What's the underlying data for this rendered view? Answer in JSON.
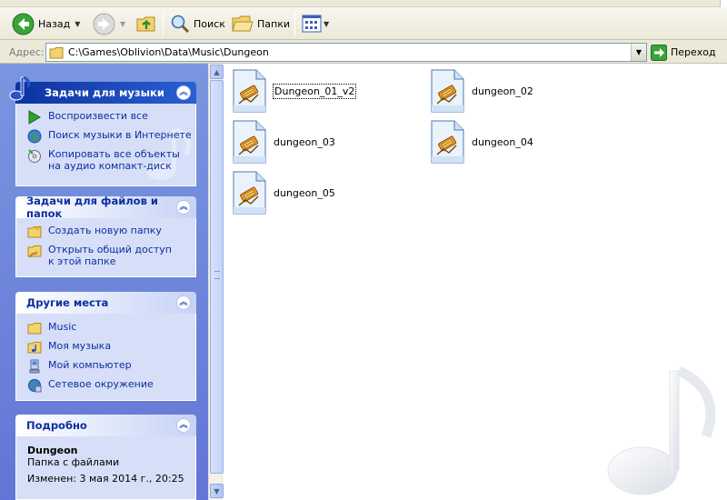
{
  "toolbar": {
    "back_label": "Назад",
    "search_label": "Поиск",
    "folders_label": "Папки"
  },
  "address": {
    "label": "Адрес:",
    "path": "C:\\Games\\Oblivion\\Data\\Music\\Dungeon",
    "go_label": "Переход"
  },
  "left_panel": {
    "music_tasks": {
      "title": "Задачи для музыки",
      "items": [
        {
          "label": "Воспроизвести все",
          "icon": "play-icon"
        },
        {
          "label": "Поиск музыки в Интернете",
          "icon": "globe-icon"
        },
        {
          "label": "Копировать все объекты на аудио компакт-диск",
          "icon": "cd-copy-icon"
        }
      ]
    },
    "file_tasks": {
      "title": "Задачи для файлов и папок",
      "items": [
        {
          "label": "Создать новую папку",
          "icon": "new-folder-icon"
        },
        {
          "label": "Открыть общий доступ к этой папке",
          "icon": "share-folder-icon"
        }
      ]
    },
    "other_places": {
      "title": "Другие места",
      "items": [
        {
          "label": "Music",
          "icon": "folder-icon"
        },
        {
          "label": "Моя музыка",
          "icon": "my-music-icon"
        },
        {
          "label": "Мой компьютер",
          "icon": "computer-icon"
        },
        {
          "label": "Сетевое окружение",
          "icon": "network-icon"
        }
      ]
    },
    "details": {
      "title": "Подробно",
      "name": "Dungeon",
      "type": "Папка с файлами",
      "modified": "Изменен: 3 мая 2014 г., 20:25"
    }
  },
  "files": [
    {
      "name": "Dungeon_01_v2",
      "icon": "winamp-playlist-icon",
      "focused": true
    },
    {
      "name": "dungeon_02",
      "icon": "winamp-playlist-icon"
    },
    {
      "name": "dungeon_03",
      "icon": "winamp-playlist-icon"
    },
    {
      "name": "dungeon_04",
      "icon": "winamp-playlist-icon"
    },
    {
      "name": "dungeon_05",
      "icon": "winamp-playlist-icon"
    }
  ],
  "colors": {
    "task_link": "#0c2ea0",
    "panel_bg": "#d6dff7",
    "left_gradient_top": "#7a96df",
    "special_header": "#0c32a0"
  }
}
